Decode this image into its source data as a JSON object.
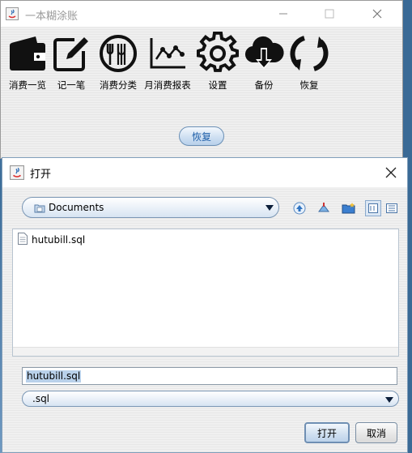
{
  "main_window": {
    "title": "一本糊涂账",
    "toolbar": [
      {
        "id": "overview",
        "label": "消费一览",
        "icon": "wallet-icon"
      },
      {
        "id": "record",
        "label": "记一笔",
        "icon": "edit-icon"
      },
      {
        "id": "category",
        "label": "消费分类",
        "icon": "dining-icon"
      },
      {
        "id": "report",
        "label": "月消费报表",
        "icon": "line-chart-icon"
      },
      {
        "id": "settings",
        "label": "设置",
        "icon": "gear-icon"
      },
      {
        "id": "backup",
        "label": "备份",
        "icon": "cloud-download-icon"
      },
      {
        "id": "restore",
        "label": "恢复",
        "icon": "refresh-icon"
      }
    ],
    "restore_button": "恢复"
  },
  "dialog": {
    "title": "打开",
    "look_in": "Documents",
    "files": [
      {
        "name": "hutubill.sql"
      }
    ],
    "file_name": "hutubill.sql",
    "file_filter": ".sql",
    "open_button": "打开",
    "cancel_button": "取消"
  }
}
